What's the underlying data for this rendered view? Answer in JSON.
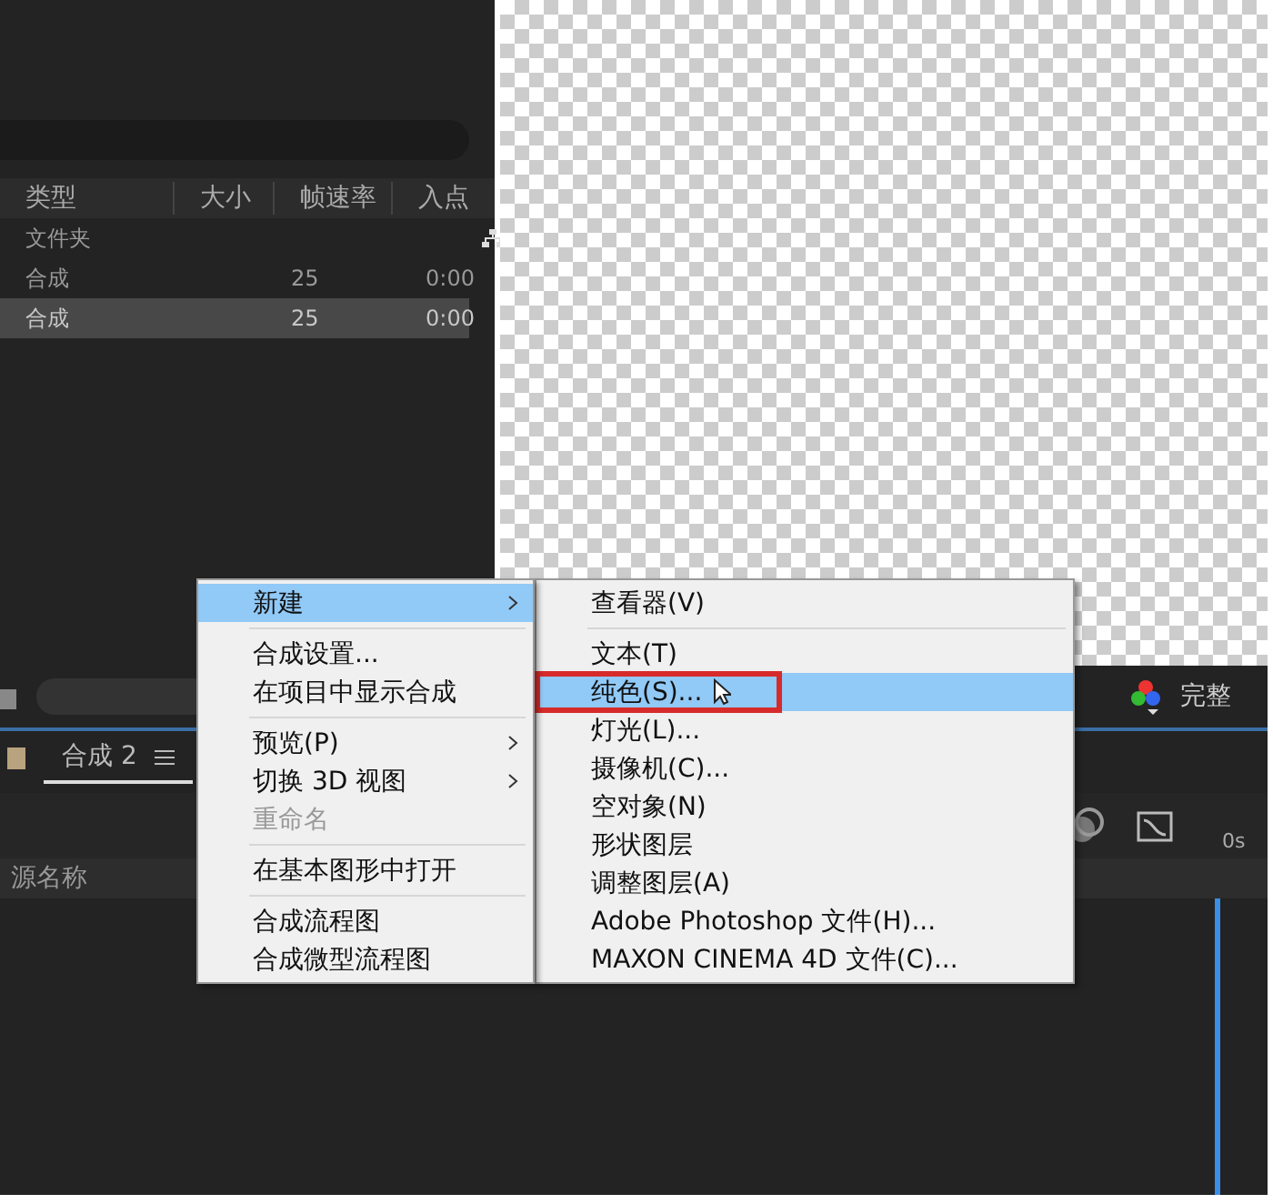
{
  "project_panel": {
    "columns": [
      "类型",
      "大小",
      "帧速率",
      "入点"
    ],
    "rows": [
      {
        "kind": "folder",
        "type": "文件夹",
        "size": "",
        "fps": "",
        "in_point": "",
        "selected": false
      },
      {
        "kind": "comp",
        "type": "合成",
        "size": "",
        "fps": "25",
        "in_point": "0:00",
        "selected": false
      },
      {
        "kind": "comp",
        "type": "合成",
        "size": "",
        "fps": "25",
        "in_point": "0:00",
        "selected": true
      }
    ]
  },
  "viewer": {
    "quality": "完整"
  },
  "timeline": {
    "tab": {
      "label": "合成 2",
      "selected": true
    },
    "column": "源名称",
    "time": "0s"
  },
  "context_menu": {
    "groups": [
      [
        {
          "label": "新建",
          "submenu": true,
          "disabled": false,
          "selected": true
        }
      ],
      [
        {
          "label": "合成设置...",
          "submenu": false,
          "disabled": false,
          "selected": false
        },
        {
          "label": "在项目中显示合成",
          "submenu": false,
          "disabled": false,
          "selected": false
        }
      ],
      [
        {
          "label": "预览(P)",
          "submenu": true,
          "disabled": false,
          "selected": false
        },
        {
          "label": "切换 3D 视图",
          "submenu": true,
          "disabled": false,
          "selected": false
        },
        {
          "label": "重命名",
          "submenu": false,
          "disabled": true,
          "selected": false
        }
      ],
      [
        {
          "label": "在基本图形中打开",
          "submenu": false,
          "disabled": false,
          "selected": false
        }
      ],
      [
        {
          "label": "合成流程图",
          "submenu": false,
          "disabled": false,
          "selected": false
        },
        {
          "label": "合成微型流程图",
          "submenu": false,
          "disabled": false,
          "selected": false
        }
      ]
    ]
  },
  "submenu": {
    "groups": [
      [
        {
          "label": "查看器(V)",
          "selected": false,
          "marked": false
        }
      ],
      [
        {
          "label": "文本(T)",
          "selected": false,
          "marked": false
        },
        {
          "label": "纯色(S)...",
          "selected": true,
          "marked": true
        },
        {
          "label": "灯光(L)...",
          "selected": false,
          "marked": false
        },
        {
          "label": "摄像机(C)...",
          "selected": false,
          "marked": false
        },
        {
          "label": "空对象(N)",
          "selected": false,
          "marked": false
        },
        {
          "label": "形状图层",
          "selected": false,
          "marked": false
        },
        {
          "label": "调整图层(A)",
          "selected": false,
          "marked": false
        },
        {
          "label": "Adobe Photoshop 文件(H)...",
          "selected": false,
          "marked": false
        },
        {
          "label": "MAXON CINEMA 4D 文件(C)...",
          "selected": false,
          "marked": false
        }
      ]
    ]
  }
}
